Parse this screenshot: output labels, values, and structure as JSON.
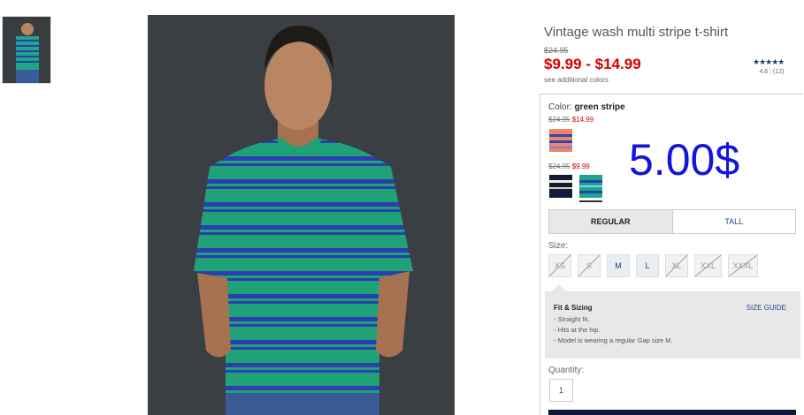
{
  "product": {
    "title": "Vintage wash multi stripe t-shirt",
    "original_price": "$24.95",
    "price_range": "$9.99 - $14.99",
    "see_colors": "see additional colors",
    "rating": {
      "stars": "★★★★★",
      "score": "4.6",
      "count": "(12)"
    }
  },
  "color": {
    "label": "Color: ",
    "selected": "green stripe",
    "groups": [
      {
        "original": "$24.95",
        "sale": "$14.99",
        "swatches": [
          "coral-stripe"
        ]
      },
      {
        "original": "$24.95",
        "sale": "$9.99",
        "swatches": [
          "navy-stripe",
          "green-stripe"
        ]
      }
    ]
  },
  "overlay_text": "5.00$",
  "fit_tabs": [
    {
      "label": "REGULAR",
      "active": true
    },
    {
      "label": "TALL",
      "active": false
    }
  ],
  "size": {
    "label": "Size:",
    "options": [
      {
        "label": "XS",
        "available": false
      },
      {
        "label": "S",
        "available": false
      },
      {
        "label": "M",
        "available": true
      },
      {
        "label": "L",
        "available": true
      },
      {
        "label": "XL",
        "available": false
      },
      {
        "label": "XXL",
        "available": false
      },
      {
        "label": "XXXL",
        "available": false
      }
    ]
  },
  "fit_sizing": {
    "title": "Fit & Sizing",
    "guide_link": "SIZE GUIDE",
    "bullets": [
      "- Straight fit.",
      "- Hits at the hip.",
      "- Model is wearing a regular Gap size M."
    ]
  },
  "quantity": {
    "label": "Quantity:",
    "value": "1"
  },
  "colors": {
    "sale_red": "#d50000",
    "link_blue": "#1e4a8c",
    "overlay_blue": "#1414dc"
  }
}
